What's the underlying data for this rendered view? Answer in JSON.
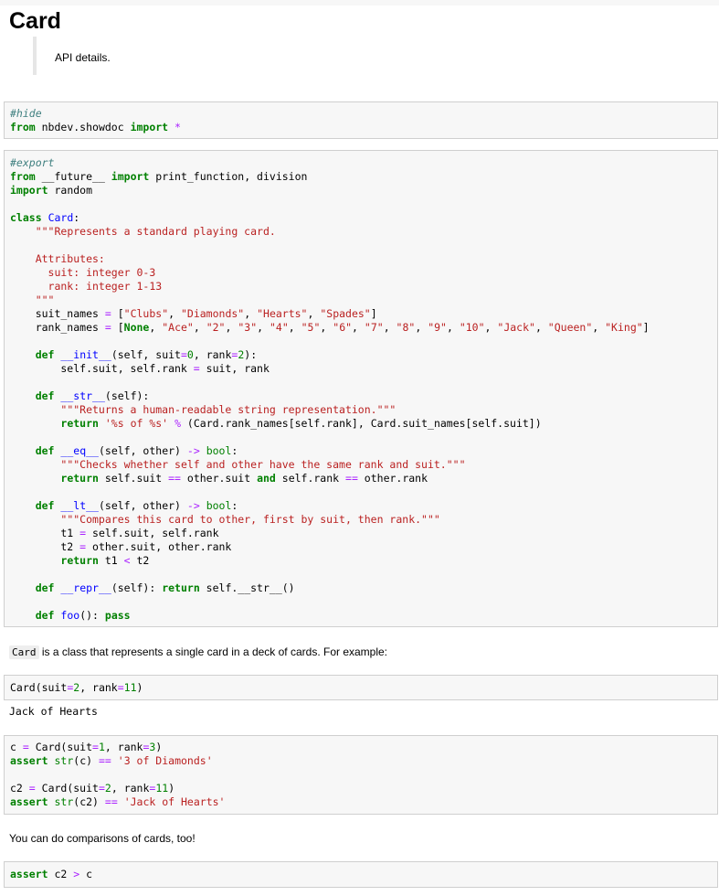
{
  "page": {
    "title": "Card",
    "subtitle": "API details."
  },
  "cells": {
    "hide": {
      "comment": "#hide",
      "line2": "from nbdev.showdoc import *"
    },
    "export": {
      "comment": "#export",
      "lines": [
        "from __future__ import print_function, division",
        "import random",
        "",
        "class Card:",
        "    \"\"\"Represents a standard playing card.",
        "",
        "    Attributes:",
        "      suit: integer 0-3",
        "      rank: integer 1-13",
        "    \"\"\"",
        "    suit_names = [\"Clubs\", \"Diamonds\", \"Hearts\", \"Spades\"]",
        "    rank_names = [None, \"Ace\", \"2\", \"3\", \"4\", \"5\", \"6\", \"7\", \"8\", \"9\", \"10\", \"Jack\", \"Queen\", \"King\"]",
        "",
        "    def __init__(self, suit=0, rank=2):",
        "        self.suit, self.rank = suit, rank",
        "",
        "    def __str__(self):",
        "        \"\"\"Returns a human-readable string representation.\"\"\"",
        "        return '%s of %s' % (Card.rank_names[self.rank], Card.suit_names[self.suit])",
        "",
        "    def __eq__(self, other) -> bool:",
        "        \"\"\"Checks whether self and other have the same rank and suit.\"\"\"",
        "        return self.suit == other.suit and self.rank == other.rank",
        "",
        "    def __lt__(self, other) -> bool:",
        "        \"\"\"Compares this card to other, first by suit, then rank.\"\"\"",
        "        t1 = self.suit, self.rank",
        "        t2 = other.suit, other.rank",
        "        return t1 < t2",
        "",
        "    def __repr__(self): return self.__str__()",
        "",
        "    def foo(): pass"
      ]
    },
    "example": {
      "code": "Card(suit=2, rank=11)",
      "output": "Jack of Hearts"
    },
    "asserts": {
      "lines": [
        "c = Card(suit=1, rank=3)",
        "assert str(c) == '3 of Diamonds'",
        "",
        "c2 = Card(suit=2, rank=11)",
        "assert str(c2) == 'Jack of Hearts'"
      ]
    },
    "compare": {
      "code": "assert c2 > c"
    }
  },
  "text": {
    "card_code": "Card",
    "card_desc": " is a class that represents a single card in a deck of cards. For example:",
    "comparisons": "You can do comparisons of cards, too!"
  },
  "colors": {
    "keyword": "#008000",
    "comment": "#408080",
    "string": "#ba2121",
    "operator": "#aa22ff",
    "class_name": "#0000ff",
    "cell_bg": "#f7f7f7",
    "cell_border": "#cfcfcf"
  }
}
